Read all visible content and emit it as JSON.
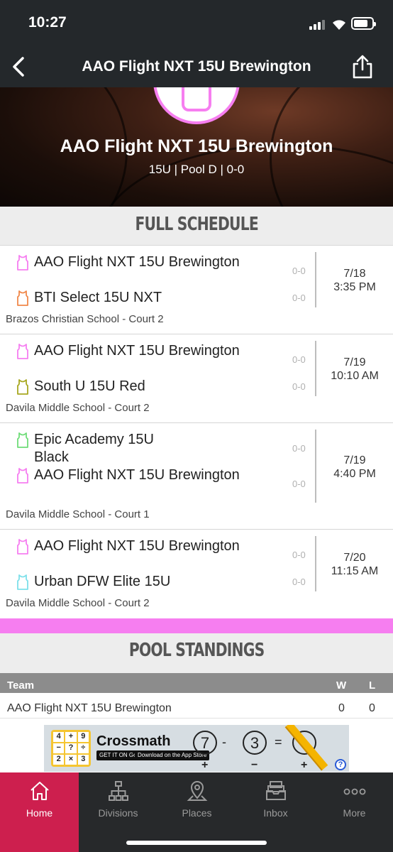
{
  "status_bar": {
    "time": "10:27"
  },
  "nav": {
    "title": "AAO Flight NXT 15U Brewington"
  },
  "hero": {
    "title": "AAO Flight NXT 15U Brewington",
    "subtitle": "15U | Pool D | 0-0"
  },
  "schedule": {
    "heading": "FULL SCHEDULE",
    "games": [
      {
        "team1": {
          "name": "AAO Flight NXT 15U Brewington",
          "score": "0-0",
          "color": "#f67ef0"
        },
        "team2": {
          "name": "BTI Select 15U NXT",
          "score": "0-0",
          "color": "#f0884a"
        },
        "date": "7/18",
        "time": "3:35 PM",
        "venue": "Brazos Christian School - Court 2"
      },
      {
        "team1": {
          "name": "AAO Flight NXT 15U Brewington",
          "score": "0-0",
          "color": "#f67ef0"
        },
        "team2": {
          "name": "South U 15U Red",
          "score": "0-0",
          "color": "#a8a820"
        },
        "date": "7/19",
        "time": "10:10 AM",
        "venue": "Davila Middle School - Court 2"
      },
      {
        "team1": {
          "name": "Epic Academy 15U Black",
          "score": "0-0",
          "color": "#6fdc78"
        },
        "team2": {
          "name": "AAO Flight NXT 15U Brewington",
          "score": "0-0",
          "color": "#f67ef0"
        },
        "date": "7/19",
        "time": "4:40 PM",
        "venue": "Davila Middle School - Court 1"
      },
      {
        "team1": {
          "name": "AAO Flight NXT 15U Brewington",
          "score": "0-0",
          "color": "#f67ef0"
        },
        "team2": {
          "name": "Urban DFW Elite 15U",
          "score": "0-0",
          "color": "#7ee0ea"
        },
        "date": "7/20",
        "time": "11:15 AM",
        "venue": "Davila Middle School - Court 2"
      }
    ]
  },
  "standings": {
    "heading": "POOL STANDINGS",
    "columns": {
      "team": "Team",
      "w": "W",
      "l": "L"
    },
    "rows": [
      {
        "team": "AAO Flight NXT 15U Brewington",
        "w": "0",
        "l": "0"
      }
    ]
  },
  "ad": {
    "brand": "Crossmath",
    "store1": "GET IT ON Google Play",
    "store2": "Download on the App Store",
    "grid": [
      "4",
      "+",
      "9",
      "−",
      "?",
      "÷",
      "2",
      "×",
      "3"
    ],
    "puzzle": [
      "7",
      "-",
      "3",
      "=",
      ""
    ],
    "signs": [
      "+",
      "−",
      "+"
    ]
  },
  "tabs": [
    {
      "label": "Home",
      "icon": "home-icon",
      "active": true
    },
    {
      "label": "Divisions",
      "icon": "divisions-icon",
      "active": false
    },
    {
      "label": "Places",
      "icon": "location-pin-icon",
      "active": false
    },
    {
      "label": "Inbox",
      "icon": "inbox-icon",
      "active": false
    },
    {
      "label": "More",
      "icon": "more-dots-icon",
      "active": false
    }
  ],
  "colors": {
    "accent": "#f67ef0",
    "tab_active": "#cd1f4e",
    "header_dark": "#24282b"
  }
}
